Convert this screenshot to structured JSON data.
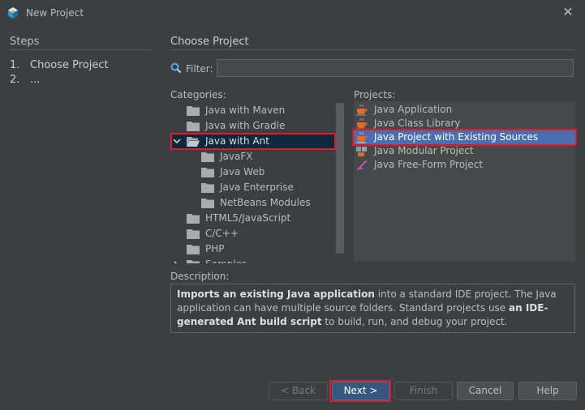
{
  "window": {
    "title": "New Project"
  },
  "steps": {
    "header": "Steps",
    "items": [
      {
        "num": "1.",
        "label": "Choose Project"
      },
      {
        "num": "2.",
        "label": "..."
      }
    ]
  },
  "main": {
    "header": "Choose Project",
    "filter": {
      "label": "Filter:",
      "value": ""
    },
    "categories_label": "Categories:",
    "projects_label": "Projects:",
    "categories": [
      "Java with Maven",
      "Java with Gradle",
      "Java with Ant",
      "JavaFX",
      "Java Web",
      "Java Enterprise",
      "NetBeans Modules",
      "HTML5/JavaScript",
      "C/C++",
      "PHP",
      "Samples"
    ],
    "selected_category": "Java with Ant",
    "projects": [
      "Java Application",
      "Java Class Library",
      "Java Project with Existing Sources",
      "Java Modular Project",
      "Java Free-Form Project"
    ],
    "selected_project": "Java Project with Existing Sources",
    "description_label": "Description:",
    "description": {
      "p1_bold": "Imports an existing Java application",
      "p2": " into a standard IDE project. The Java application can have multiple source folders. Standard projects use ",
      "p3_bold": "an IDE-generated Ant build script",
      "p4": " to build, run, and debug your project."
    }
  },
  "buttons": {
    "back": "< Back",
    "next": "Next >",
    "finish": "Finish",
    "cancel": "Cancel",
    "help": "Help"
  },
  "colors": {
    "background": "#3c3f41",
    "selection": "#4b6eaf",
    "highlight": "#e01b24",
    "primary_button": "#365880"
  }
}
